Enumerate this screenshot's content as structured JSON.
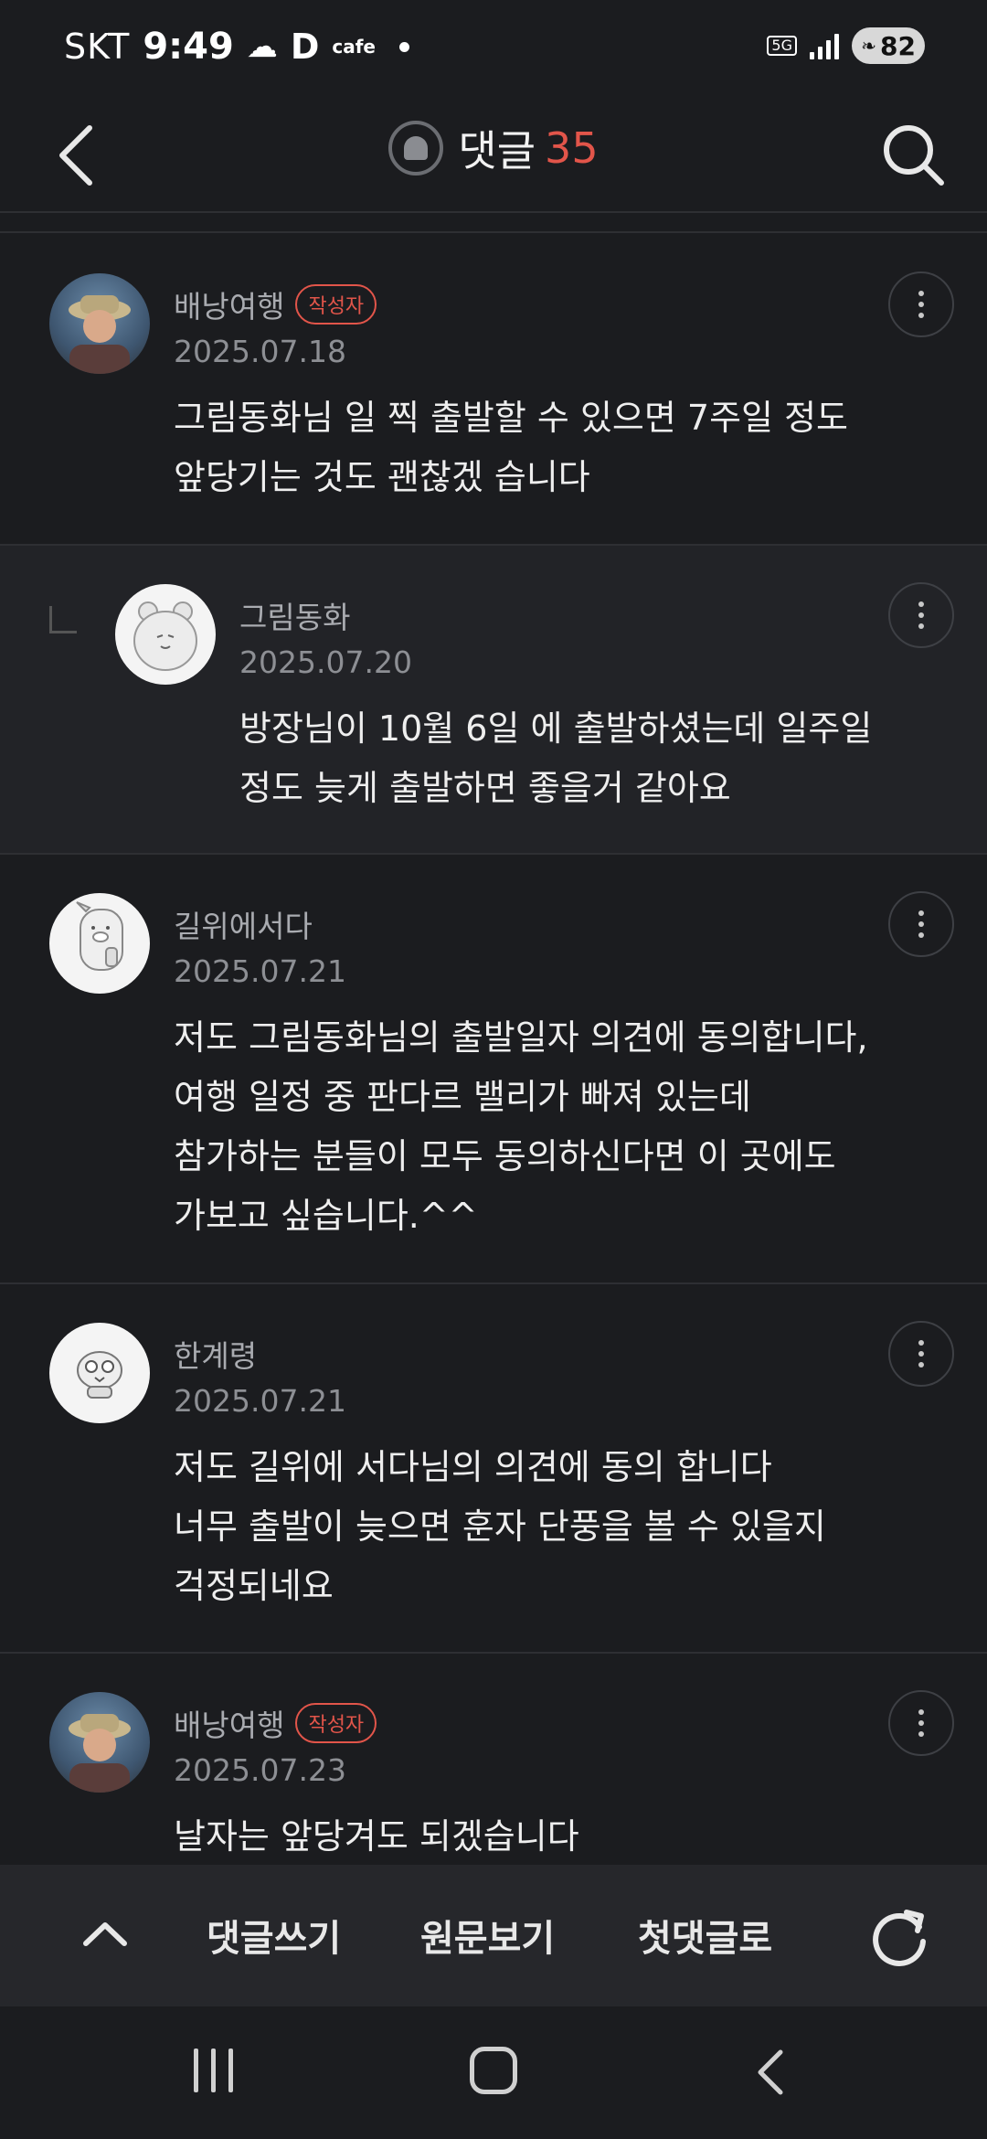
{
  "status_bar": {
    "carrier": "SKT",
    "time": "9:49",
    "app_letter": "D",
    "app_label": "cafe",
    "network": "5G",
    "battery": "82"
  },
  "header": {
    "title": "댓글",
    "count": "35"
  },
  "comments": [
    {
      "author": "배낭여행",
      "badge": "작성자",
      "date": "2025.07.18",
      "text": "그림동화님 일 찍 출발할 수 있으면 7주일 정도\n앞당기는 것도 괜찮겠 습니다"
    },
    {
      "author": "그림동화",
      "date": "2025.07.20",
      "text": "방장님이 10월 6일 에 출발하셨는데 일주일\n정도 늦게 출발하면 좋을거 같아요"
    },
    {
      "author": "길위에서다",
      "date": "2025.07.21",
      "text": "저도 그림동화님의 출발일자 의견에 동의합니다,\n여행 일정 중 판다르 밸리가 빠져 있는데\n참가하는 분들이 모두 동의하신다면 이 곳에도\n가보고 싶습니다.^^"
    },
    {
      "author": "한계령",
      "date": "2025.07.21",
      "text": "저도 길위에 서다님의 의견에 동의 합니다\n너무 출발이 늦으면 훈자 단풍을 볼 수 있을지\n걱정되네요"
    },
    {
      "author": "배낭여행",
      "badge": "작성자",
      "date": "2025.07.23",
      "text": "날자는 앞당겨도 되겠습니다"
    }
  ],
  "toolbar": {
    "write": "댓글쓰기",
    "original": "원문보기",
    "first": "첫댓글로"
  },
  "colors": {
    "background": "#1b1c1f",
    "accent": "#e2554a",
    "reply_background": "#222327"
  }
}
